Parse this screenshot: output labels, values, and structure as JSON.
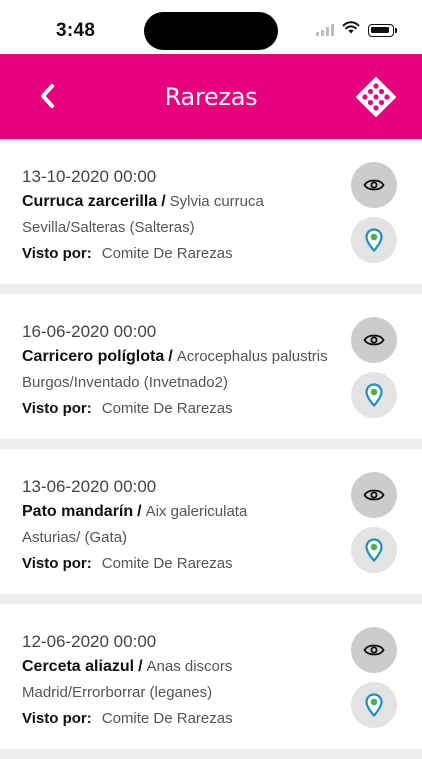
{
  "status_bar": {
    "time": "3:48"
  },
  "header": {
    "title": "Rarezas",
    "back_icon": "chevron-left-icon",
    "logo_icon": "dots-diamond-logo-icon",
    "background": "#e6007e"
  },
  "sightings": [
    {
      "date": "13-10-2020 00:00",
      "common_name": "Curruca zarcerilla",
      "separator": "/",
      "scientific_name": "Sylvia curruca",
      "location": "Sevilla/Salteras (Salteras)",
      "seen_by_label": "Visto por:",
      "seen_by": "Comite De Rarezas"
    },
    {
      "date": "16-06-2020 00:00",
      "common_name": "Carricero políglota",
      "separator": "/",
      "scientific_name": "Acrocephalus palustris",
      "location": "Burgos/Inventado (Invetnado2)",
      "seen_by_label": "Visto por:",
      "seen_by": "Comite De Rarezas"
    },
    {
      "date": "13-06-2020 00:00",
      "common_name": "Pato mandarín",
      "separator": "/",
      "scientific_name": "Aix galericulata",
      "location": "Asturias/ (Gata)",
      "seen_by_label": "Visto por:",
      "seen_by": "Comite De Rarezas"
    },
    {
      "date": "12-06-2020 00:00",
      "common_name": "Cerceta aliazul",
      "separator": "/",
      "scientific_name": "Anas discors",
      "location": "Madrid/Errorborrar (leganes)",
      "seen_by_label": "Visto por:",
      "seen_by": "Comite De Rarezas"
    }
  ],
  "icons": {
    "view": "eye-icon",
    "map": "map-pin-icon"
  },
  "colors": {
    "accent": "#e6007e",
    "pin": "#1e8fc2",
    "pin_center": "#4caf50"
  }
}
